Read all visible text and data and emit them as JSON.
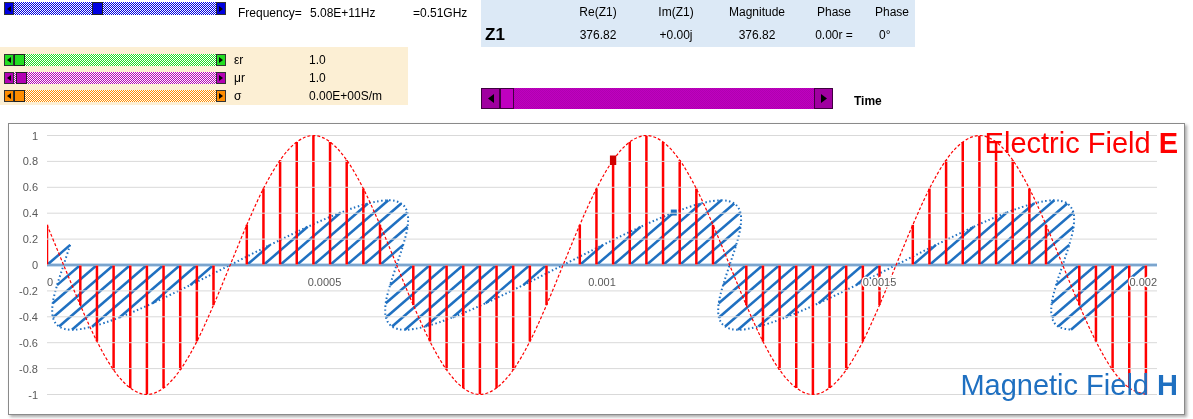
{
  "frequency_slider": {
    "level": 0.41,
    "color": "#0000e0"
  },
  "frequency": {
    "label": "Frequency=",
    "value": "5.08E+11Hz",
    "converted": "=0.51GHz"
  },
  "impedance_table": {
    "row_label": "Z1",
    "columns": [
      "Re(Z1)",
      "Im(Z1)",
      "Magnitude",
      "Phase",
      "Phase"
    ],
    "values": [
      "376.82",
      "+0.00j",
      "376.82",
      "0.00r =",
      "0°"
    ]
  },
  "material_parameters": [
    {
      "symbol": "εr",
      "value": "1.0",
      "level": 0,
      "color": "#22dd22"
    },
    {
      "symbol": "μr",
      "value": "1.0",
      "level": 0.01,
      "color": "#b400b4"
    },
    {
      "symbol": "σ",
      "value": "0.00E+00S/m",
      "level": 0,
      "color": "#ff8c00"
    }
  ],
  "time_slider": {
    "level": 0,
    "label": "Time"
  },
  "chart": {
    "chart_data": {
      "type": "line",
      "grid": true,
      "xlim": [
        0,
        0.002
      ],
      "ylim": [
        -1,
        1
      ],
      "xticks": [
        0,
        0.0005,
        0.001,
        0.0015,
        0.002
      ],
      "yticks": [
        -1,
        -0.8,
        -0.6,
        -0.4,
        -0.2,
        0,
        0.2,
        0.4,
        0.6,
        0.8,
        1
      ],
      "x": [
        0,
        3e-05,
        6e-05,
        9e-05,
        0.00012,
        0.00015,
        0.00018,
        0.00021,
        0.00024,
        0.00027,
        0.0003,
        0.00033,
        0.00036,
        0.00039,
        0.00042,
        0.00045,
        0.00048,
        0.00051,
        0.00054,
        0.00057,
        0.0006,
        0.00063,
        0.00066,
        0.00069,
        0.00072,
        0.00075,
        0.00078,
        0.00081,
        0.00084,
        0.00087,
        0.0009,
        0.00093,
        0.00096,
        0.00099,
        0.00102,
        0.00105,
        0.00108,
        0.00111,
        0.00114,
        0.00117,
        0.0012,
        0.00123,
        0.00126,
        0.00129,
        0.00132,
        0.00135,
        0.00138,
        0.00141,
        0.00144,
        0.00147,
        0.0015,
        0.00153,
        0.00156,
        0.00159,
        0.00162,
        0.00165,
        0.00168,
        0.00171,
        0.00174,
        0.00177,
        0.0018,
        0.00183,
        0.00186,
        0.00189,
        0.00192,
        0.00195,
        0.00198
      ],
      "series": [
        {
          "name": "Electric Field",
          "color": "#ff0000",
          "line_style": "dashed",
          "values": [
            0.31,
            0,
            -0.31,
            -0.59,
            -0.81,
            -0.95,
            -1,
            -0.95,
            -0.81,
            -0.59,
            -0.31,
            0,
            0.31,
            0.59,
            0.81,
            0.95,
            1,
            0.95,
            0.81,
            0.59,
            0.31,
            0,
            -0.31,
            -0.59,
            -0.81,
            -0.95,
            -1,
            -0.95,
            -0.81,
            -0.59,
            -0.31,
            0,
            0.31,
            0.59,
            0.81,
            0.95,
            1,
            0.95,
            0.81,
            0.59,
            0.31,
            0,
            -0.31,
            -0.59,
            -0.81,
            -0.95,
            -1,
            -0.95,
            -0.81,
            -0.59,
            -0.31,
            0,
            0.31,
            0.59,
            0.81,
            0.95,
            1,
            0.95,
            0.81,
            0.59,
            0.31,
            0,
            -0.31,
            -0.59,
            -0.81,
            -0.95,
            -1
          ]
        }
      ],
      "annotations": [
        {
          "x": 0.00102,
          "y": 0.81,
          "text": "█"
        }
      ]
    },
    "electric_symbol": "E",
    "magnetic_label": {
      "name": "Magnetic Field",
      "symbol": "H",
      "color": "#1f70c1"
    }
  }
}
